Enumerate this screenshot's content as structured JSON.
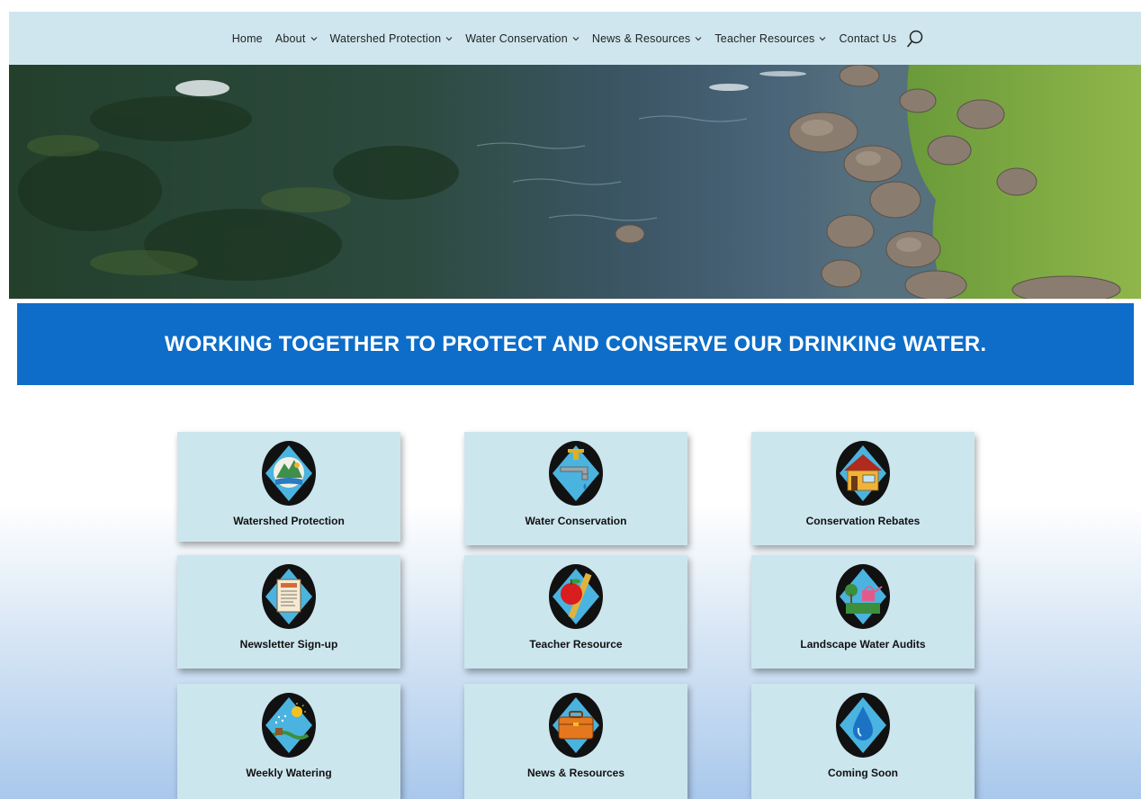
{
  "nav": {
    "items": [
      {
        "label": "Home",
        "dropdown": false
      },
      {
        "label": "About",
        "dropdown": true
      },
      {
        "label": "Watershed Protection",
        "dropdown": true
      },
      {
        "label": "Water Conservation",
        "dropdown": true
      },
      {
        "label": "News & Resources",
        "dropdown": true
      },
      {
        "label": "Teacher Resources",
        "dropdown": true
      },
      {
        "label": "Contact Us",
        "dropdown": false
      }
    ],
    "search_icon": "search-icon"
  },
  "banner": {
    "text": "WORKING TOGETHER TO PROTECT AND CONSERVE OUR DRINKING WATER."
  },
  "cards": [
    {
      "label": "Watershed Protection",
      "icon": "mountain-river-icon"
    },
    {
      "label": "Water Conservation",
      "icon": "faucet-icon"
    },
    {
      "label": "Conservation Rebates",
      "icon": "house-icon"
    },
    {
      "label": "Newsletter Sign-up",
      "icon": "newsletter-icon"
    },
    {
      "label": "Teacher Resource",
      "icon": "apple-ruler-icon"
    },
    {
      "label": "Landscape Water Audits",
      "icon": "watering-can-icon"
    },
    {
      "label": "Weekly Watering",
      "icon": "sprinkler-icon"
    },
    {
      "label": "News & Resources",
      "icon": "toolbox-icon"
    },
    {
      "label": "Coming Soon",
      "icon": "water-drop-icon"
    }
  ],
  "colors": {
    "nav_bg": "#cfe6ef",
    "banner_bg": "#0d6dc9",
    "card_bg": "#cce6ee",
    "emblem_diamond": "#4bb3df"
  }
}
